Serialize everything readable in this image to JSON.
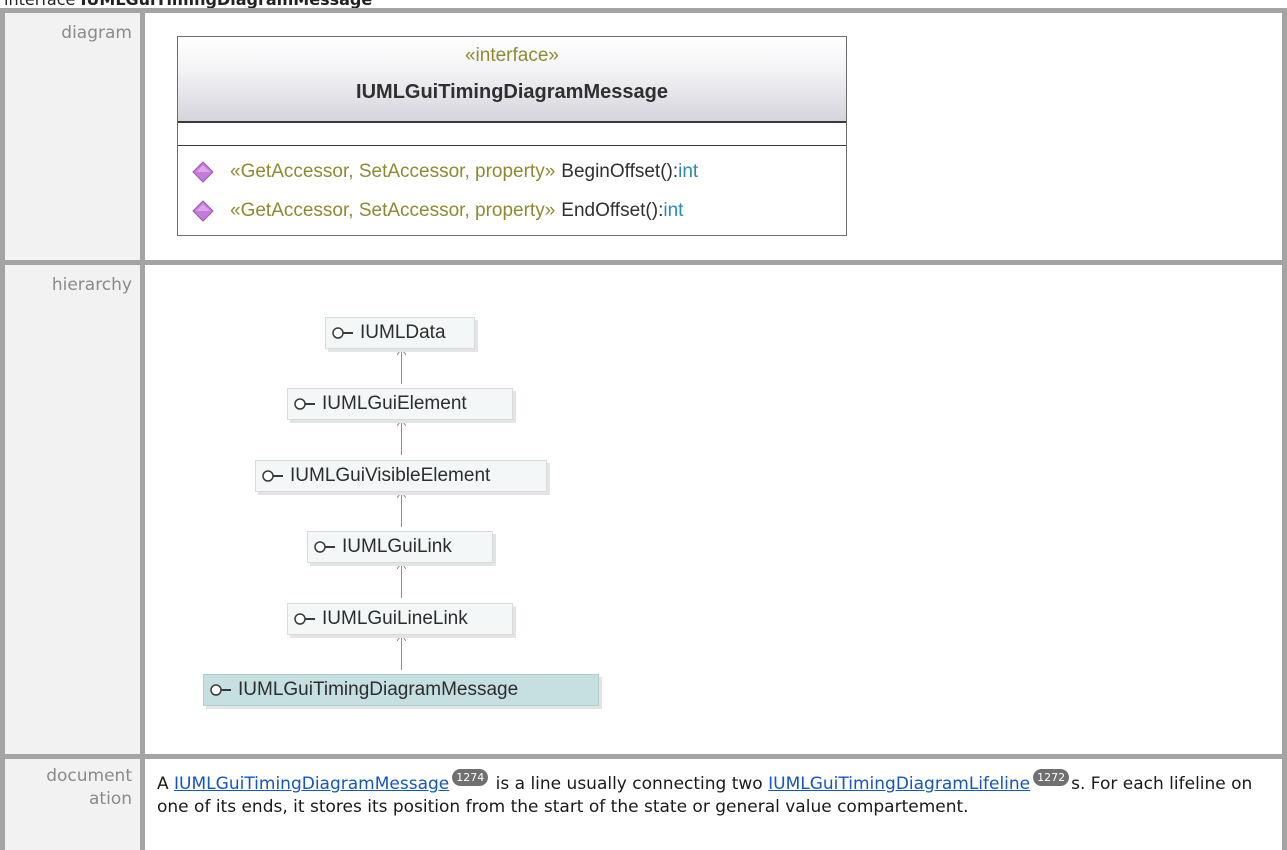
{
  "page_heading": {
    "prefix": "interface ",
    "name": "IUMLGuiTimingDiagramMessage"
  },
  "rows": {
    "diagram_label": "diagram",
    "hierarchy_label": "hierarchy",
    "documentation_label_line1": "document",
    "documentation_label_line2": "ation"
  },
  "uml_class": {
    "stereotype": "«interface»",
    "name": "IUMLGuiTimingDiagramMessage",
    "operations": [
      {
        "stereotype": "«GetAccessor, SetAccessor, property»",
        "name": "BeginOffset():",
        "type": "int",
        "icon": "operation-diamond-icon"
      },
      {
        "stereotype": "«GetAccessor, SetAccessor, property»",
        "name": "EndOffset():",
        "type": "int",
        "icon": "operation-diamond-icon"
      }
    ]
  },
  "hierarchy": [
    {
      "name": "IUMLData",
      "current": false
    },
    {
      "name": "IUMLGuiElement",
      "current": false
    },
    {
      "name": "IUMLGuiVisibleElement",
      "current": false
    },
    {
      "name": "IUMLGuiLink",
      "current": false
    },
    {
      "name": "IUMLGuiLineLink",
      "current": false
    },
    {
      "name": "IUMLGuiTimingDiagramMessage",
      "current": true
    }
  ],
  "documentation": {
    "part1": "A ",
    "link1": "IUMLGuiTimingDiagramMessage",
    "badge1": "1274",
    "part2": " is a line usually connecting two ",
    "link2": "IUMLGuiTimingDiagramLifeline",
    "badge2": "1272",
    "part3": "s. For each lifeline on one of its ends, it stores its position from the start of the state or general value compartement."
  },
  "colors": {
    "stereotype": "#8f8a32",
    "type": "#2a8ab7",
    "link": "#1355c2",
    "diamond": "#c77ad9",
    "current_node": "#c6dfe1"
  }
}
